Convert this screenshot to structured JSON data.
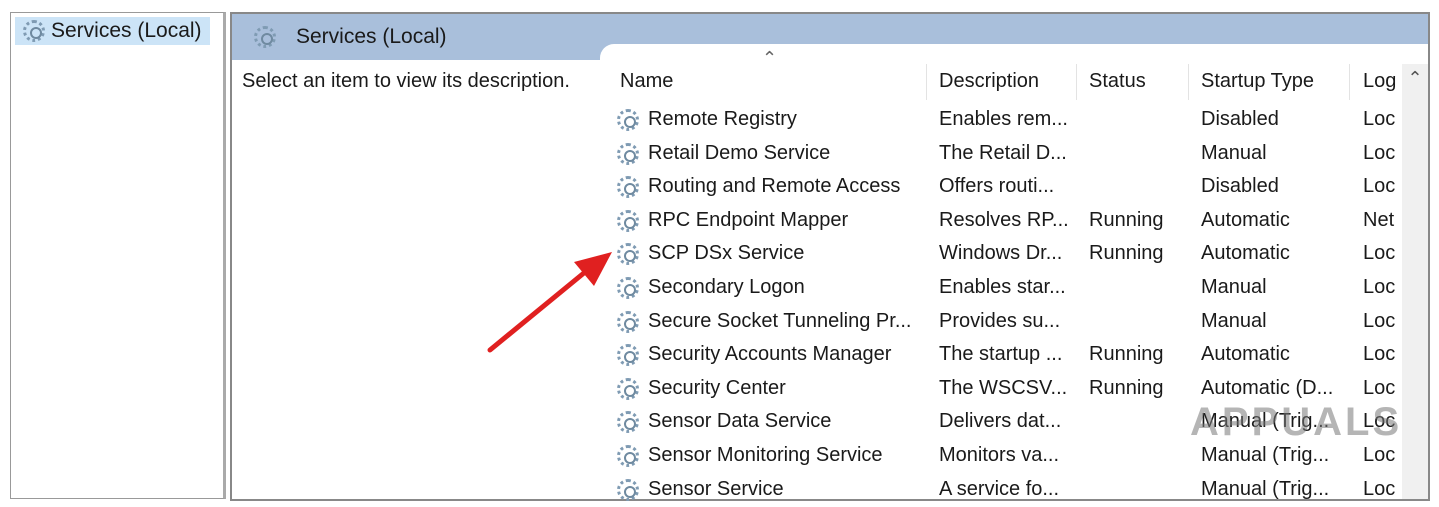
{
  "tree": {
    "selected": "Services (Local)"
  },
  "panel": {
    "title": "Services (Local)",
    "description_hint": "Select an item to view its description."
  },
  "columns": [
    "Name",
    "Description",
    "Status",
    "Startup Type",
    "Log"
  ],
  "rows": [
    [
      "Remote Registry",
      "Enables rem...",
      "",
      "Disabled",
      "Loc"
    ],
    [
      "Retail Demo Service",
      "The Retail D...",
      "",
      "Manual",
      "Loc"
    ],
    [
      "Routing and Remote Access",
      "Offers routi...",
      "",
      "Disabled",
      "Loc"
    ],
    [
      "RPC Endpoint Mapper",
      "Resolves RP...",
      "Running",
      "Automatic",
      "Net"
    ],
    [
      "SCP DSx Service",
      "Windows Dr...",
      "Running",
      "Automatic",
      "Loc"
    ],
    [
      "Secondary Logon",
      "Enables star...",
      "",
      "Manual",
      "Loc"
    ],
    [
      "Secure Socket Tunneling Pr...",
      "Provides su...",
      "",
      "Manual",
      "Loc"
    ],
    [
      "Security Accounts Manager",
      "The startup ...",
      "Running",
      "Automatic",
      "Loc"
    ],
    [
      "Security Center",
      "The WSCSV...",
      "Running",
      "Automatic (D...",
      "Loc"
    ],
    [
      "Sensor Data Service",
      "Delivers dat...",
      "",
      "Manual (Trig...",
      "Loc"
    ],
    [
      "Sensor Monitoring Service",
      "Monitors va...",
      "",
      "Manual (Trig...",
      "Loc"
    ],
    [
      "Sensor Service",
      "A service fo...",
      "",
      "Manual (Trig...",
      "Loc"
    ]
  ],
  "watermark": "APPUALS",
  "colors": {
    "header": "#a9bfdb",
    "arrow": "#e02020",
    "selection": "#cce4f7"
  }
}
